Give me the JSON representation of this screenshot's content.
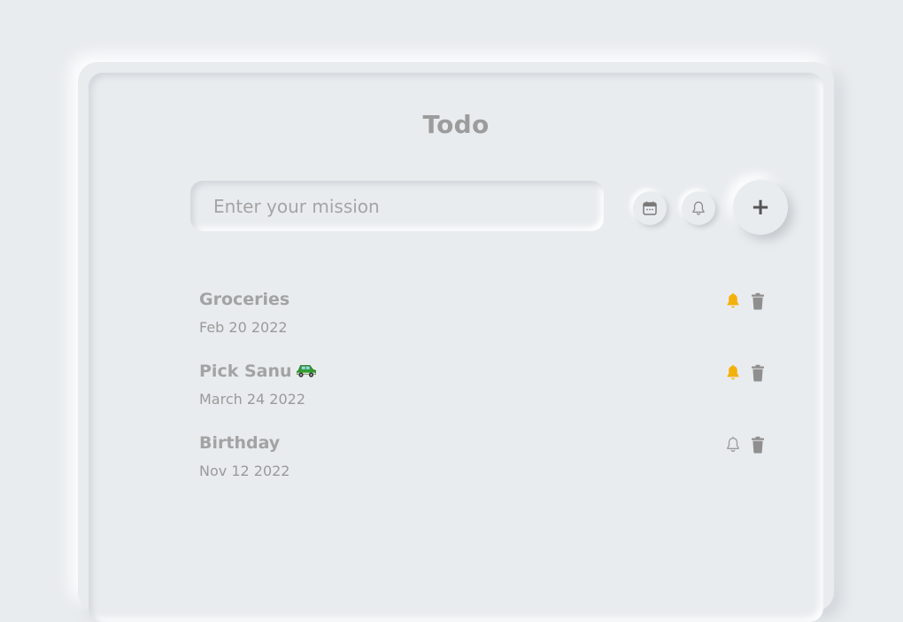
{
  "app": {
    "title": "Todo"
  },
  "input": {
    "placeholder": "Enter your mission",
    "value": ""
  },
  "toolbar": {
    "date_icon": "calendar-icon",
    "reminder_icon": "bell-outline-icon",
    "add_label": "+"
  },
  "colors": {
    "background": "#e9ecef",
    "reminder_on": "#f4b10c",
    "reminder_off": "#9a9a9a",
    "trash": "#8f8f8f"
  },
  "tasks": [
    {
      "name": "Groceries",
      "emoji": "",
      "date": "Feb 20 2022",
      "reminder": true
    },
    {
      "name": "Pick Sanu",
      "emoji": "car-icon",
      "date": "March 24 2022",
      "reminder": true
    },
    {
      "name": "Birthday",
      "emoji": "",
      "date": "Nov 12 2022",
      "reminder": false
    }
  ]
}
